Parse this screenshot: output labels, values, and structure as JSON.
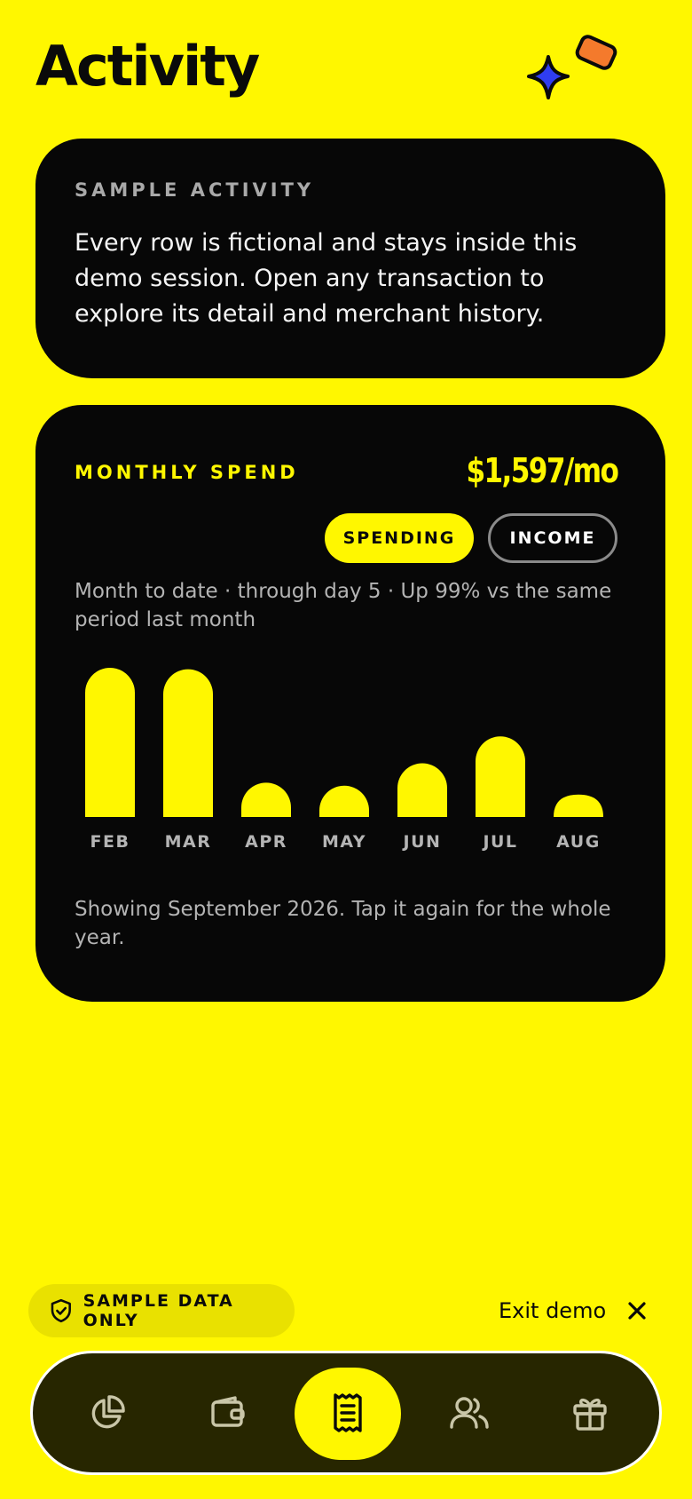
{
  "header": {
    "title": "Activity"
  },
  "intro_card": {
    "eyebrow": "SAMPLE ACTIVITY",
    "body": "Every row is fictional and stays inside this demo session. Open any transaction to explore its detail and merchant history."
  },
  "spend_card": {
    "eyebrow": "MONTHLY SPEND",
    "total": "$1,597/mo",
    "toggle": {
      "spending_label": "SPENDING",
      "income_label": "INCOME",
      "selected": "SPENDING"
    },
    "subtitle": "Month to date · through day 5 · Up 99% vs the same period last month",
    "footnote": "Showing September 2026. Tap it again for the whole year."
  },
  "chart_data": {
    "type": "bar",
    "categories": [
      "FEB",
      "MAR",
      "APR",
      "MAY",
      "JUN",
      "JUL",
      "AUG"
    ],
    "values": [
      1.0,
      0.99,
      0.23,
      0.21,
      0.36,
      0.54,
      0.15
    ],
    "bar_color": "#FFF700",
    "label_color": "#b4b4b4",
    "grid": false
  },
  "footer": {
    "badge_label": "SAMPLE DATA ONLY",
    "exit_label": "Exit demo"
  },
  "nav": {
    "items": [
      {
        "icon": "pie-chart-icon",
        "active": false
      },
      {
        "icon": "wallet-icon",
        "active": false
      },
      {
        "icon": "receipt-icon",
        "active": true
      },
      {
        "icon": "users-icon",
        "active": false
      },
      {
        "icon": "gift-icon",
        "active": false
      }
    ]
  },
  "colors": {
    "background": "#FFF700",
    "card": "#070707",
    "accent": "#FFF700",
    "sparkle": "#2f3df0",
    "tag": "#f47a2c"
  }
}
